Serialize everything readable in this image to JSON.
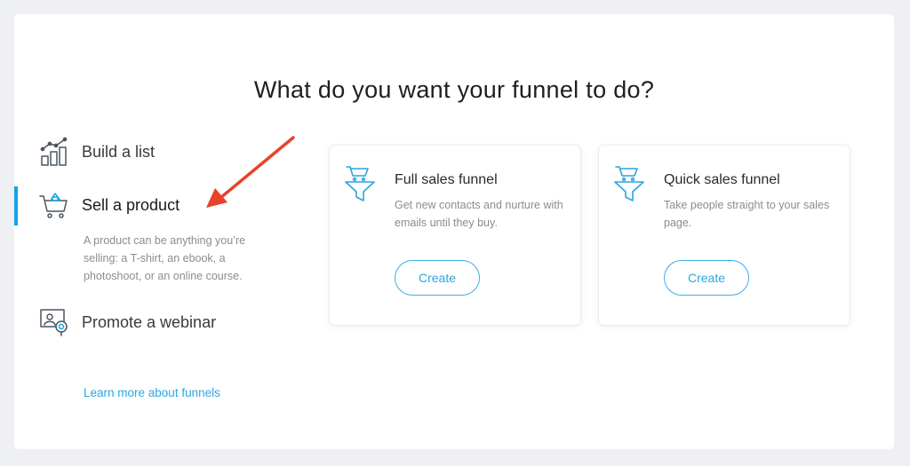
{
  "page": {
    "title": "What do you want your funnel to do?"
  },
  "goals": {
    "items": [
      {
        "label": "Build a list",
        "icon": "bar-chart-icon"
      },
      {
        "label": "Sell a product",
        "icon": "shopping-cart-icon",
        "active": true,
        "description": "A product can be anything you’re selling: a T-shirt, an ebook, a photoshoot, or an online course."
      },
      {
        "label": "Promote a webinar",
        "icon": "webinar-icon"
      }
    ],
    "learn_more": "Learn more about funnels"
  },
  "funnels": [
    {
      "title": "Full sales funnel",
      "description": "Get new contacts and nurture with emails until they buy.",
      "button": "Create",
      "icon": "funnel-cart-icon"
    },
    {
      "title": "Quick sales funnel",
      "description": "Take people straight to your sales page.",
      "button": "Create",
      "icon": "funnel-cart-icon"
    }
  ],
  "colors": {
    "accent": "#15a2e6",
    "annotation_arrow": "#e8412c"
  }
}
